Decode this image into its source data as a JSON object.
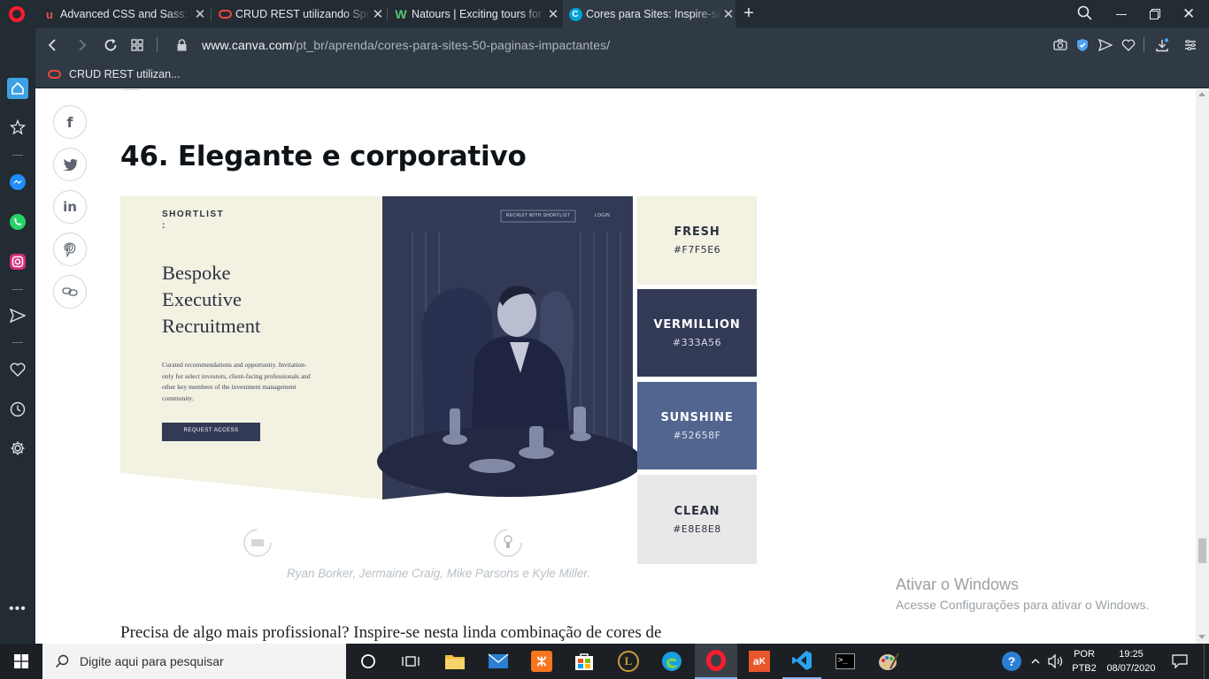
{
  "browser": {
    "tabs": [
      {
        "title": "Advanced CSS and Sass: Fle",
        "icon": "udemy-icon",
        "color": "#ec5252"
      },
      {
        "title": "CRUD REST utilizando Sprin",
        "icon": "oracle-icon",
        "color": "#f2473f"
      },
      {
        "title": "Natours | Exciting tours for",
        "icon": "natours-icon",
        "color": "#55c57a"
      },
      {
        "title": "Cores para Sites: Inspire-se",
        "icon": "canva-icon",
        "color": "#00c4cc"
      }
    ],
    "url_domain": "www.canva.com",
    "url_path": "/pt_br/aprenda/cores-para-sites-50-paginas-impactantes/",
    "bookmark": "CRUD REST utilizan..."
  },
  "article": {
    "heading": "46. Elegante e corporativo",
    "caption": "Ryan Borker, Jermaine Craig, Mike Parsons e Kyle Miller.",
    "paragraph": "Precisa de algo mais profissional? Inspire-se nesta linda combinação de cores de"
  },
  "figure": {
    "brand": "SHORTLIST",
    "brand_colon": ":",
    "headline_lines": [
      "Bespoke",
      "Executive",
      "Recruitment"
    ],
    "body_lines": [
      "Curated recommendations and opportunity. Invitation-",
      "only for select investors, client-facing professionals and",
      "other key members of the investment management",
      "community."
    ],
    "cta": "REQUEST ACCESS",
    "nav_recruit": "RECRUIT WITH SHORTLIST",
    "nav_login": "LOGIN",
    "swatches": [
      {
        "name": "FRESH",
        "hex": "#F7F5E6",
        "bg": "#f2f1e2",
        "fg": "#2c3140"
      },
      {
        "name": "VERMILLION",
        "hex": "#333A56",
        "bg": "#333a56",
        "fg": "#ffffff"
      },
      {
        "name": "SUNSHINE",
        "hex": "#52658F",
        "bg": "#52658f",
        "fg": "#ffffff"
      },
      {
        "name": "CLEAN",
        "hex": "#E8E8E8",
        "bg": "#e8e8e8",
        "fg": "#2c3140"
      }
    ]
  },
  "watermark": {
    "title": "Ativar o Windows",
    "subtitle": "Acesse Configurações para ativar o Windows."
  },
  "taskbar": {
    "search_placeholder": "Digite aqui para pesquisar",
    "lang_top": "POR",
    "lang_bottom": "PTB2",
    "time": "19:25",
    "date": "08/07/2020"
  }
}
